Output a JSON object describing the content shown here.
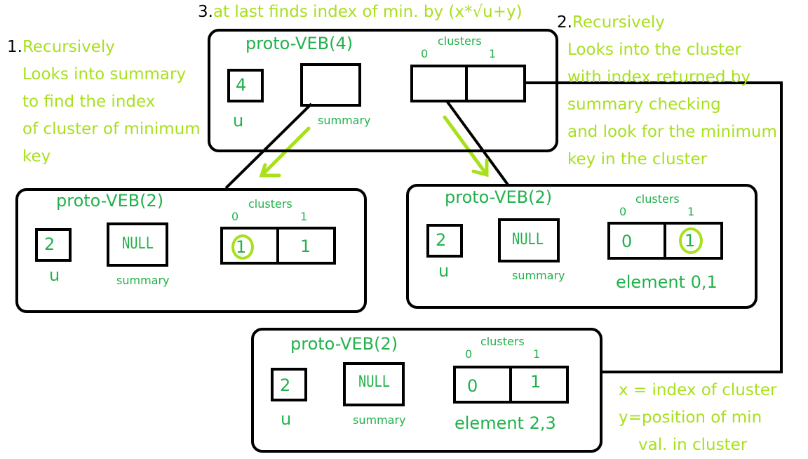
{
  "notes": {
    "step1": {
      "number": "1.",
      "lines": [
        "Recursively",
        "Looks into summary",
        "to find the index",
        "of cluster of minimum",
        "key"
      ]
    },
    "step2": {
      "number": "2.",
      "lines": [
        "Recursively",
        "Looks into the cluster",
        "with index returned by",
        "summary checking",
        "and look for the minimum",
        "key in the cluster"
      ]
    },
    "step3": {
      "number": "3.",
      "text": "at last finds index of min. by (x*√u+y)"
    },
    "legend": {
      "lines": [
        "x = index of cluster",
        "y=position of min",
        "val. in cluster"
      ]
    }
  },
  "nodes": {
    "top": {
      "title": "proto-VEB(4)",
      "u_value": "4",
      "u_label": "u",
      "summary_value": "",
      "summary_label": "summary",
      "clusters_label": "clusters",
      "cluster_indices": [
        "0",
        "1"
      ],
      "cluster_values": [
        "",
        ""
      ]
    },
    "left": {
      "title": "proto-VEB(2)",
      "u_value": "2",
      "u_label": "u",
      "summary_value": "NULL",
      "summary_label": "summary",
      "clusters_label": "clusters",
      "cluster_indices": [
        "0",
        "1"
      ],
      "cluster_values": [
        "1",
        "1"
      ],
      "highlighted_cluster": 0
    },
    "right": {
      "title": "proto-VEB(2)",
      "u_value": "2",
      "u_label": "u",
      "summary_value": "NULL",
      "summary_label": "summary",
      "clusters_label": "clusters",
      "cluster_indices": [
        "0",
        "1"
      ],
      "cluster_values": [
        "0",
        "1"
      ],
      "highlighted_cluster": 1,
      "caption": "element 0,1"
    },
    "bottom": {
      "title": "proto-VEB(2)",
      "u_value": "2",
      "u_label": "u",
      "summary_value": "NULL",
      "summary_label": "summary",
      "clusters_label": "clusters",
      "cluster_indices": [
        "0",
        "1"
      ],
      "cluster_values": [
        "0",
        "1"
      ],
      "caption": "element 2,3"
    }
  },
  "colors": {
    "annotation": "#a8e01e",
    "label": "#22b14c",
    "stroke": "#000000"
  }
}
